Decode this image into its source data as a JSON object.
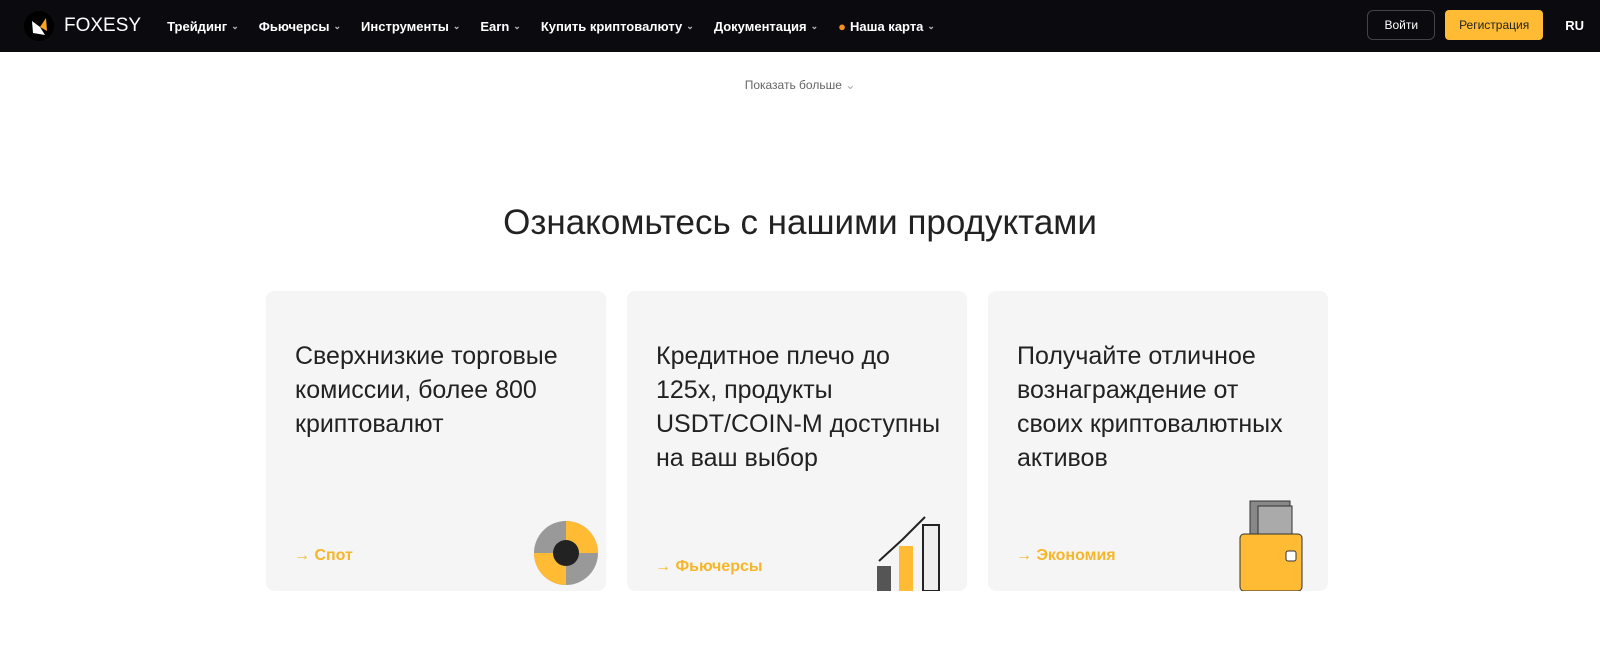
{
  "nav": {
    "brand": "FOXESY",
    "items": [
      {
        "label": "Трейдинг"
      },
      {
        "label": "Фьючерсы"
      },
      {
        "label": "Инструменты"
      },
      {
        "label": "Earn"
      },
      {
        "label": "Купить криптовалюту"
      },
      {
        "label": "Документация"
      },
      {
        "label": "Наша карта"
      }
    ],
    "login": "Войти",
    "register": "Регистрация",
    "lang": "RU"
  },
  "show_more": "Показать больше",
  "section_title": "Ознакомьтесь с нашими продуктами",
  "cards": [
    {
      "text": "Сверхнизкие торговые комиссии, более 800 криптовалют",
      "link": "Спот"
    },
    {
      "text": "Кредитное плечо до 125x, продукты USDT/COIN-M доступны на ваш выбор",
      "link": "Фьючерсы"
    },
    {
      "text": "Получайте отличное вознаграждение от своих криптовалютных активов",
      "link": "Экономия"
    }
  ],
  "colors": {
    "accent": "#ffbb33",
    "nav_bg": "#0b0a0e"
  }
}
